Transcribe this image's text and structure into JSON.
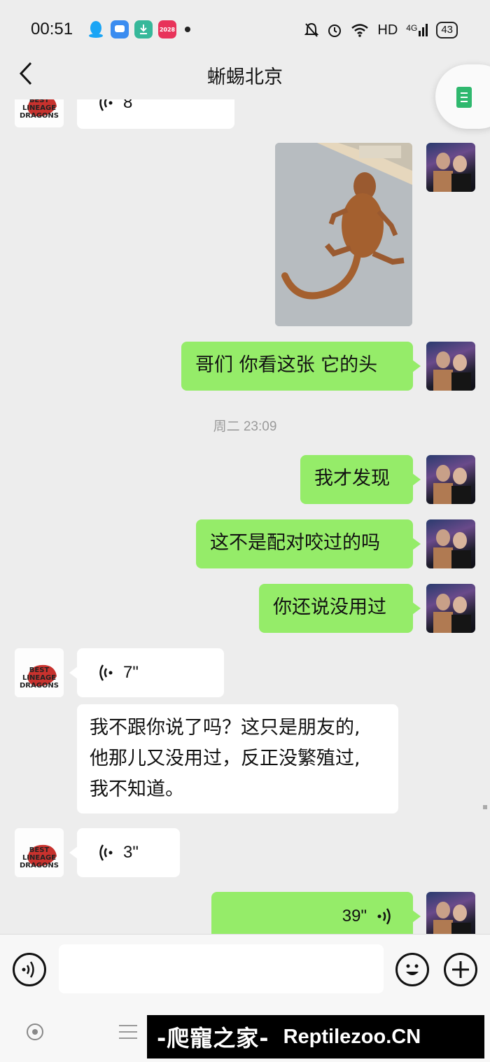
{
  "status_bar": {
    "time": "00:51",
    "network": "HD",
    "signal": "4G",
    "battery": "43",
    "app_badge": "2028"
  },
  "header": {
    "title": "蜥蜴北京"
  },
  "messages": {
    "top_partial_voice": "8",
    "text_1": "哥们 你看这张 它的头",
    "timestamp": "周二 23:09",
    "text_2": "我才发现",
    "text_3": "这不是配对咬过的吗",
    "text_4": "你还说没用过",
    "voice_1": "7\"",
    "reply_line_1": "我不跟你说了吗？这只是朋友的,",
    "reply_line_2": "他那儿又没用过，反正没繁殖过,",
    "reply_line_3": "我不知道。",
    "voice_2": "3\"",
    "voice_self": "39\""
  },
  "avatar_other": {
    "logo_lines": [
      "BEST",
      "LINEAGE",
      "DRAGONS"
    ]
  },
  "input_bar": {
    "placeholder": ""
  },
  "watermark": {
    "cn": "-爬寵之家-",
    "en": "Reptilezoo.CN"
  },
  "colors": {
    "background": "#ededed",
    "self_bubble": "#95ec69",
    "other_bubble": "#ffffff"
  }
}
